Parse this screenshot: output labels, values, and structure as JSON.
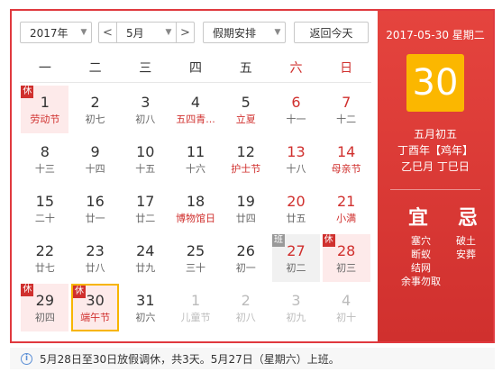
{
  "controls": {
    "year": "2017年",
    "month": "5月",
    "prev_symbol": "<",
    "next_symbol": ">",
    "holiday_select": "假期安排",
    "today_button": "返回今天"
  },
  "weekdays": [
    "一",
    "二",
    "三",
    "四",
    "五",
    "六",
    "日"
  ],
  "weeks": [
    [
      {
        "day": "1",
        "sub": "劳动节",
        "badge": "休",
        "type": "rest",
        "festival": true
      },
      {
        "day": "2",
        "sub": "初七"
      },
      {
        "day": "3",
        "sub": "初八"
      },
      {
        "day": "4",
        "sub": "五四青...",
        "festival": true
      },
      {
        "day": "5",
        "sub": "立夏",
        "festival": true
      },
      {
        "day": "6",
        "sub": "十一",
        "weekend": true
      },
      {
        "day": "7",
        "sub": "十二",
        "weekend": true
      }
    ],
    [
      {
        "day": "8",
        "sub": "十三"
      },
      {
        "day": "9",
        "sub": "十四"
      },
      {
        "day": "10",
        "sub": "十五"
      },
      {
        "day": "11",
        "sub": "十六"
      },
      {
        "day": "12",
        "sub": "护士节",
        "festival": true
      },
      {
        "day": "13",
        "sub": "十八",
        "weekend": true
      },
      {
        "day": "14",
        "sub": "母亲节",
        "weekend": true,
        "festival": true
      }
    ],
    [
      {
        "day": "15",
        "sub": "二十"
      },
      {
        "day": "16",
        "sub": "廿一"
      },
      {
        "day": "17",
        "sub": "廿二"
      },
      {
        "day": "18",
        "sub": "博物馆日",
        "festival": true
      },
      {
        "day": "19",
        "sub": "廿四"
      },
      {
        "day": "20",
        "sub": "廿五",
        "weekend": true
      },
      {
        "day": "21",
        "sub": "小满",
        "weekend": true,
        "festival": true
      }
    ],
    [
      {
        "day": "22",
        "sub": "廿七"
      },
      {
        "day": "23",
        "sub": "廿八"
      },
      {
        "day": "24",
        "sub": "廿九"
      },
      {
        "day": "25",
        "sub": "三十"
      },
      {
        "day": "26",
        "sub": "初一"
      },
      {
        "day": "27",
        "sub": "初二",
        "badge": "班",
        "type": "work",
        "weekend": true
      },
      {
        "day": "28",
        "sub": "初三",
        "badge": "休",
        "type": "rest",
        "weekend": true
      }
    ],
    [
      {
        "day": "29",
        "sub": "初四",
        "badge": "休",
        "type": "rest"
      },
      {
        "day": "30",
        "sub": "端午节",
        "badge": "休",
        "type": "rest",
        "festival": true,
        "selected": true
      },
      {
        "day": "31",
        "sub": "初六"
      },
      {
        "day": "1",
        "sub": "儿童节",
        "other": true
      },
      {
        "day": "2",
        "sub": "初八",
        "other": true
      },
      {
        "day": "3",
        "sub": "初九",
        "other": true
      },
      {
        "day": "4",
        "sub": "初十",
        "other": true
      }
    ]
  ],
  "detail": {
    "date_line": "2017-05-30 星期二",
    "day": "30",
    "lunar": "五月初五",
    "ganzhi_year": "丁酉年【鸡年】",
    "ganzhi_month_day": "乙巳月 丁巳日",
    "yi_title": "宜",
    "ji_title": "忌",
    "yi_items": [
      "塞穴",
      "断蚁",
      "结网",
      "余事勿取"
    ],
    "ji_items": [
      "破土",
      "安葬"
    ]
  },
  "notice": "5月28日至30日放假调休，共3天。5月27日（星期六）上班。",
  "colors": {
    "accent": "#d0302e",
    "highlight": "#fbb700",
    "rest_bg": "#fdeaea",
    "work_bg": "#f1f1f1"
  }
}
